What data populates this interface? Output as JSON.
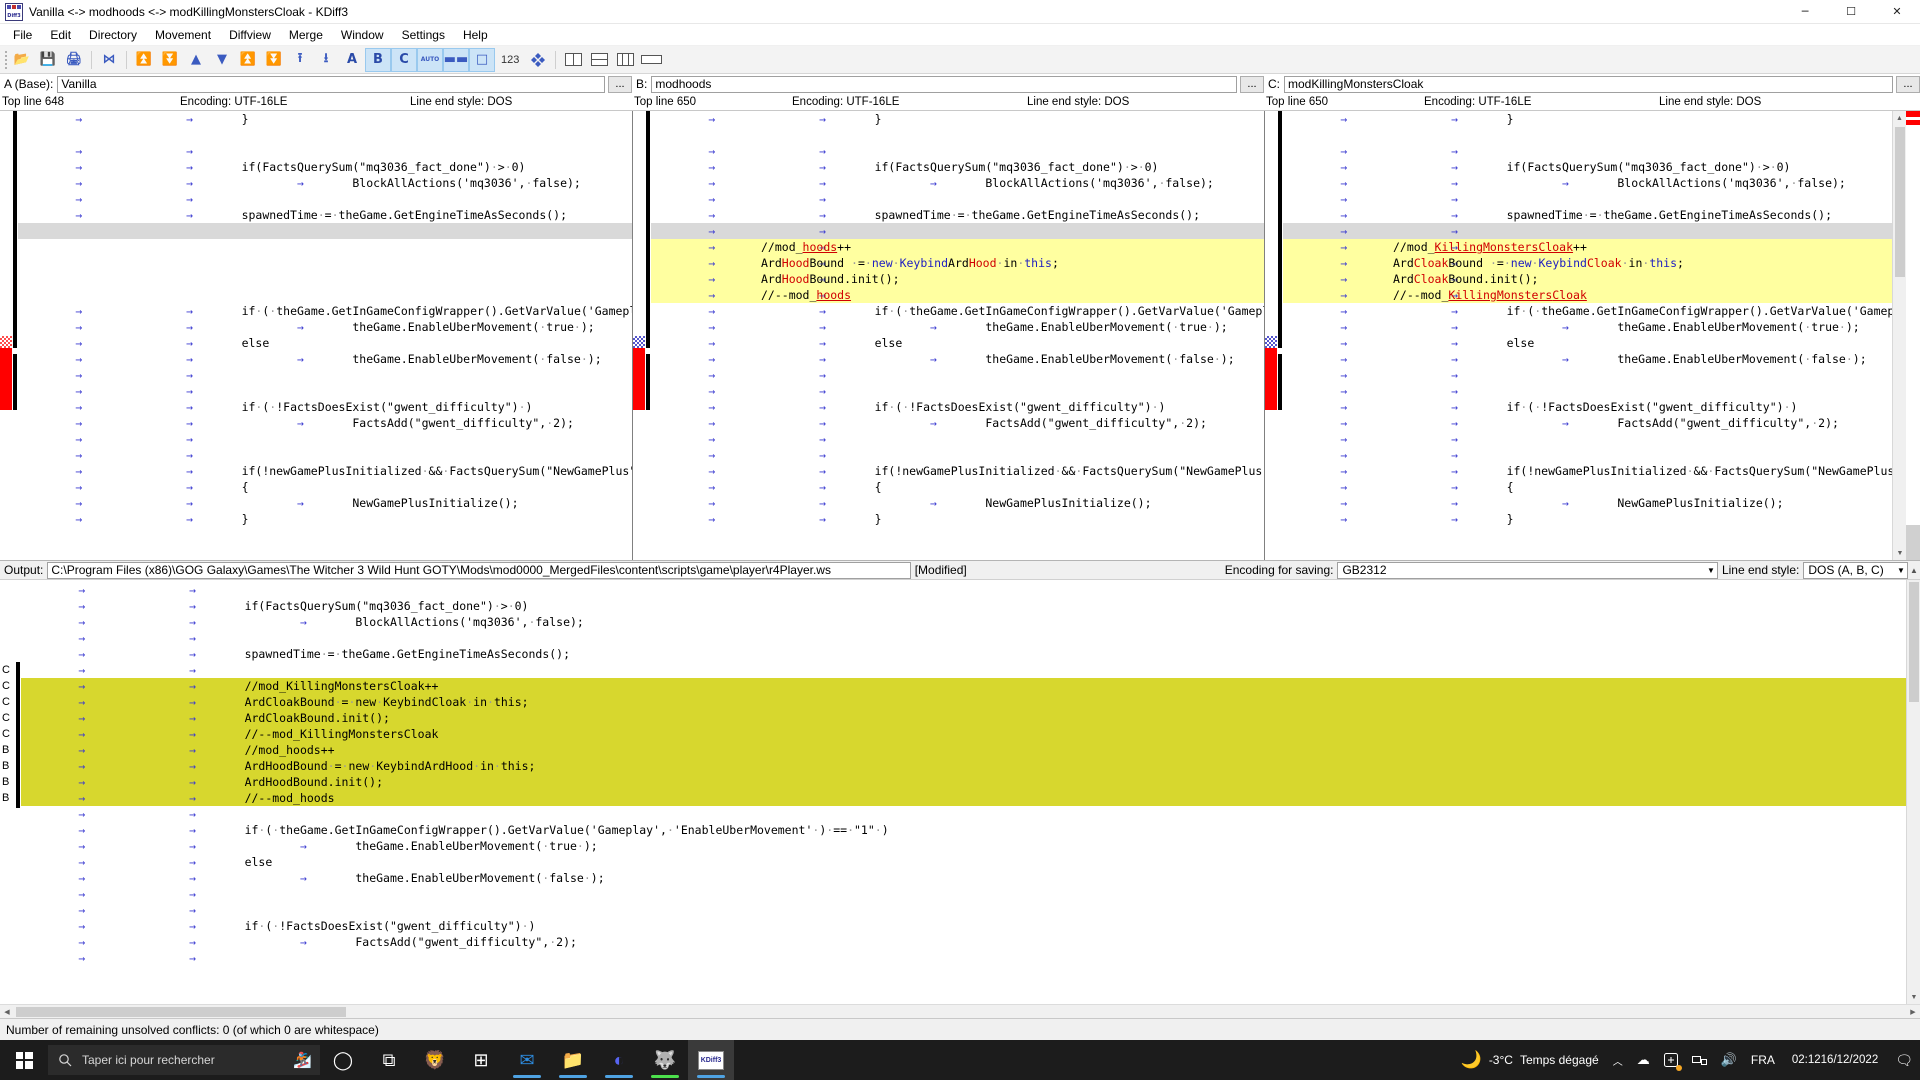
{
  "window": {
    "title": "Vanilla <-> modhoods <-> modKillingMonstersCloak - KDiff3",
    "minimize": "─",
    "maximize": "☐",
    "close": "✕"
  },
  "menu": [
    "File",
    "Edit",
    "Directory",
    "Movement",
    "Diffview",
    "Merge",
    "Window",
    "Settings",
    "Help"
  ],
  "toolbar": {
    "buttons": [
      {
        "name": "open-icon",
        "glyph": "📂",
        "active": false
      },
      {
        "name": "save-icon",
        "glyph": "💾",
        "active": false
      },
      {
        "name": "print-icon",
        "glyph": "🖨",
        "active": false
      },
      {
        "name": "compare-icon",
        "glyph": "⋈",
        "active": false
      },
      {
        "name": "goto-first-difference-icon",
        "glyph": "⏫",
        "active": false
      },
      {
        "name": "goto-last-difference-icon",
        "glyph": "⏬",
        "active": false
      },
      {
        "name": "goto-previous-difference-icon",
        "glyph": "▲",
        "active": false
      },
      {
        "name": "goto-next-difference-icon",
        "glyph": "▼",
        "active": false
      },
      {
        "name": "goto-previous-conflict-icon",
        "glyph": "⏫",
        "active": false
      },
      {
        "name": "goto-next-conflict-icon",
        "glyph": "⏬",
        "active": false
      },
      {
        "name": "goto-previous-unsolved-conflict-icon",
        "glyph": "⭱",
        "active": false
      },
      {
        "name": "goto-next-unsolved-conflict-icon",
        "glyph": "⭳",
        "active": false
      },
      {
        "name": "choose-a-everywhere-icon",
        "glyph": "A",
        "active": false
      },
      {
        "name": "choose-b-everywhere-icon",
        "glyph": "B",
        "active": true
      },
      {
        "name": "choose-c-everywhere-icon",
        "glyph": "C",
        "active": true
      },
      {
        "name": "automatic-merge-icon",
        "glyph": "AUTO",
        "active": true
      },
      {
        "name": "show-whitespace-icon",
        "glyph": "▬▬",
        "active": true
      },
      {
        "name": "show-white-space-characters-icon",
        "glyph": "□",
        "active": true
      }
    ],
    "line_numbers_label": "123",
    "extra_icon": "overview-icon"
  },
  "files": {
    "a": {
      "label": "A (Base):",
      "value": "Vanilla",
      "browse": "...",
      "top_line": "Top line 648",
      "encoding": "Encoding: UTF-16LE",
      "line_end": "Line end style: DOS"
    },
    "b": {
      "label": "B:",
      "value": "modhoods",
      "browse": "...",
      "top_line": "Top line 650",
      "encoding": "Encoding: UTF-16LE",
      "line_end": "Line end style: DOS"
    },
    "c": {
      "label": "C:",
      "value": "modKillingMonstersCloak",
      "browse": "...",
      "top_line": "Top line 650",
      "encoding": "Encoding: UTF-16LE",
      "line_end": "Line end style: DOS"
    }
  },
  "panes": {
    "a_lines": [
      {
        "state": "normal",
        "html": "\t→\t\t→\t}"
      },
      {
        "state": "normal",
        "html": ""
      },
      {
        "state": "normal",
        "html": "\t→\t\t→\t"
      },
      {
        "state": "normal",
        "html": "\t→\t\t→\tif(FactsQuerySum(\"mq3036_fact_done\")·>·0)"
      },
      {
        "state": "normal",
        "html": "\t→\t\t→\t\t→\tBlockAllActions('mq3036',·false);"
      },
      {
        "state": "normal",
        "html": "\t→\t\t→\t"
      },
      {
        "state": "normal",
        "html": "\t→\t\t→\tspawnedTime·=·theGame.GetEngineTimeAsSeconds();"
      },
      {
        "state": "blank",
        "html": ""
      },
      {
        "state": "blank",
        "html": ""
      },
      {
        "state": "blank",
        "html": ""
      },
      {
        "state": "blank",
        "html": ""
      },
      {
        "state": "blank",
        "html": ""
      },
      {
        "state": "normal",
        "html": "\t→\t\t→\tif·(·theGame.GetInGameConfigWrapper().GetVarValue('Gameplay"
      },
      {
        "state": "normal",
        "html": "\t→\t\t→\t\t→\ttheGame.EnableUberMovement(·true·);"
      },
      {
        "state": "normal",
        "html": "\t→\t\t→\telse"
      },
      {
        "state": "normal",
        "html": "\t→\t\t→\t\t→\ttheGame.EnableUberMovement(·false·);"
      },
      {
        "state": "normal",
        "html": "\t→\t\t→\t"
      },
      {
        "state": "normal",
        "html": "\t→\t\t→\t"
      },
      {
        "state": "normal",
        "html": "\t→\t\t→\tif·(·!FactsDoesExist(\"gwent_difficulty\")·)"
      },
      {
        "state": "normal",
        "html": "\t→\t\t→\t\t→\tFactsAdd(\"gwent_difficulty\",·2);"
      },
      {
        "state": "normal",
        "html": "\t→\t\t→\t"
      },
      {
        "state": "normal",
        "html": "\t→\t\t→\t"
      },
      {
        "state": "normal",
        "html": "\t→\t\t→\tif(!newGamePlusInitialized·&&·FactsQuerySum(\"NewGamePlus\")"
      },
      {
        "state": "normal",
        "html": "\t→\t\t→\t{"
      },
      {
        "state": "normal",
        "html": "\t→\t\t→\t\t→\tNewGamePlusInitialize();"
      },
      {
        "state": "normal",
        "html": "\t→\t\t→\t}"
      }
    ],
    "b_diff_lines": [
      "//mod_hoods++",
      "ArdHoodBound ·=·new·KeybindArdHood·in·this;",
      "ArdHoodBound.init();",
      "//--mod_hoods"
    ],
    "c_diff_lines": [
      "//mod_KillingMonstersCloak++",
      "ArdCloakBound ·=·new·KeybindCloak·in·this;",
      "ArdCloakBound.init();",
      "//--mod_KillingMonstersCloak"
    ]
  },
  "output": {
    "label": "Output:",
    "path": "C:\\Program Files (x86)\\GOG Galaxy\\Games\\The Witcher 3 Wild Hunt GOTY\\Mods\\mod0000_MergedFiles\\content\\scripts\\game\\player\\r4Player.ws",
    "modified": "[Modified]",
    "encoding_label": "Encoding for saving:",
    "encoding_value": "GB2312",
    "lineend_label": "Line end style:",
    "lineend_value": "DOS (A, B, C)",
    "lines": [
      {
        "src": "",
        "conflict": false,
        "text": "\t→\t\t→\t"
      },
      {
        "src": "",
        "conflict": false,
        "text": "\t→\t\t→\tif(FactsQuerySum(\"mq3036_fact_done\")·>·0)"
      },
      {
        "src": "",
        "conflict": false,
        "text": "\t→\t\t→\t\t→\tBlockAllActions('mq3036',·false);"
      },
      {
        "src": "",
        "conflict": false,
        "text": "\t→\t\t→\t"
      },
      {
        "src": "",
        "conflict": false,
        "text": "\t→\t\t→\tspawnedTime·=·theGame.GetEngineTimeAsSeconds();"
      },
      {
        "src": "C",
        "conflict": false,
        "text": "\t→\t\t→\t"
      },
      {
        "src": "C",
        "conflict": true,
        "text": "\t→\t\t→\t//mod_KillingMonstersCloak++"
      },
      {
        "src": "C",
        "conflict": true,
        "text": "\t→\t\t→\tArdCloakBound·=·new·KeybindCloak·in·this;"
      },
      {
        "src": "C",
        "conflict": true,
        "text": "\t→\t\t→\tArdCloakBound.init();"
      },
      {
        "src": "C",
        "conflict": true,
        "text": "\t→\t\t→\t//--mod_KillingMonstersCloak"
      },
      {
        "src": "B",
        "conflict": true,
        "text": "\t→\t\t→\t//mod_hoods++"
      },
      {
        "src": "B",
        "conflict": true,
        "text": "\t→\t\t→\tArdHoodBound·=·new·KeybindArdHood·in·this;"
      },
      {
        "src": "B",
        "conflict": true,
        "text": "\t→\t\t→\tArdHoodBound.init();"
      },
      {
        "src": "B",
        "conflict": true,
        "text": "\t→\t\t→\t//--mod_hoods"
      },
      {
        "src": "",
        "conflict": false,
        "text": "\t→\t\t→\t"
      },
      {
        "src": "",
        "conflict": false,
        "text": "\t→\t\t→\tif·(·theGame.GetInGameConfigWrapper().GetVarValue('Gameplay',·'EnableUberMovement'·)·==·\"1\"·)"
      },
      {
        "src": "",
        "conflict": false,
        "text": "\t→\t\t→\t\t→\ttheGame.EnableUberMovement(·true·);"
      },
      {
        "src": "",
        "conflict": false,
        "text": "\t→\t\t→\telse"
      },
      {
        "src": "",
        "conflict": false,
        "text": "\t→\t\t→\t\t→\ttheGame.EnableUberMovement(·false·);"
      },
      {
        "src": "",
        "conflict": false,
        "text": "\t→\t\t→\t"
      },
      {
        "src": "",
        "conflict": false,
        "text": "\t→\t\t→\t"
      },
      {
        "src": "",
        "conflict": false,
        "text": "\t→\t\t→\tif·(·!FactsDoesExist(\"gwent_difficulty\")·)"
      },
      {
        "src": "",
        "conflict": false,
        "text": "\t→\t\t→\t\t→\tFactsAdd(\"gwent_difficulty\",·2);"
      },
      {
        "src": "",
        "conflict": false,
        "text": "\t→\t\t→\t"
      }
    ]
  },
  "statusbar": {
    "text": "Number of remaining unsolved conflicts: 0 (of which 0 are whitespace)"
  },
  "taskbar": {
    "search_placeholder": "Taper ici pour rechercher",
    "apps": [
      {
        "name": "cortana-icon",
        "glyph": "◯",
        "color": "#ffffff",
        "underline": ""
      },
      {
        "name": "task-view-icon",
        "glyph": "⧉",
        "color": "#ffffff",
        "underline": ""
      },
      {
        "name": "brave-browser-icon",
        "glyph": "🦁",
        "color": "#eb5127",
        "underline": ""
      },
      {
        "name": "microsoft-store-icon",
        "glyph": "⊞",
        "color": "#ffffff",
        "underline": ""
      },
      {
        "name": "mail-icon",
        "glyph": "✉",
        "color": "#2d8ce0",
        "underline": "#4fa3e3"
      },
      {
        "name": "file-explorer-icon",
        "glyph": "📁",
        "color": "#ffcb4f",
        "underline": "#4fa3e3"
      },
      {
        "name": "discord-icon",
        "glyph": "◐",
        "color": "#5865f2",
        "underline": "#4fa3e3"
      },
      {
        "name": "witcher3-icon",
        "glyph": "🐺",
        "color": "#cccccc",
        "underline": "#4ce04c"
      },
      {
        "name": "kdiff3-icon",
        "glyph": "KDiff3",
        "color": "#ffffff",
        "underline": "#4fa3e3"
      }
    ],
    "weather": {
      "temp": "-3°C",
      "desc": "Temps dégagé",
      "icon": "moon-icon"
    },
    "tray_icons": [
      "chevron-up-icon",
      "onedrive-icon",
      "graphics-icon",
      "network-icon",
      "volume-icon"
    ],
    "language": "FRA",
    "time": "02:12",
    "date": "16/12/2022",
    "action_center": "notification-icon"
  },
  "colors": {
    "diff_yellow": "#ffffa0",
    "conflict_olive": "#d7d72e",
    "selection_gray": "#d9d9d9",
    "accent_blue": "#cce4f7",
    "marker_red": "#ff0000",
    "keyword_red": "#d00000",
    "tab_blue": "#3a3ad0"
  }
}
